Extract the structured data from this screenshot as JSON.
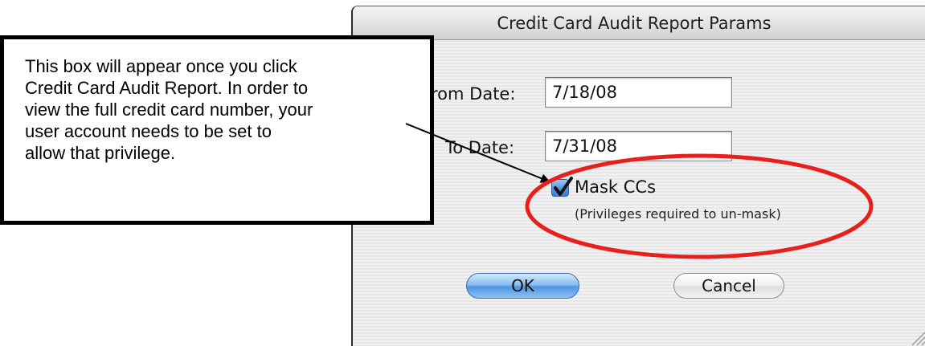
{
  "dialog": {
    "title": "Credit Card Audit Report Params",
    "from_date": {
      "label": "From Date:",
      "visible_label": "rom Date:",
      "value": "7/18/08"
    },
    "to_date": {
      "label": "To Date:",
      "value": "7/31/08"
    },
    "mask_ccs": {
      "label": "Mask CCs",
      "checked": true,
      "note": "(Privileges required to un-mask)"
    },
    "buttons": {
      "ok": "OK",
      "cancel": "Cancel"
    }
  },
  "callout": {
    "lines": [
      "This box will appear once you click",
      "Credit Card Audit Report. In order to",
      "view the full credit card number, your",
      "user account needs to be set to",
      "allow that privilege."
    ]
  },
  "colors": {
    "highlight_ellipse": "#e8201c",
    "default_button": "#4f95e2",
    "checkbox": "#3f7fd0"
  }
}
